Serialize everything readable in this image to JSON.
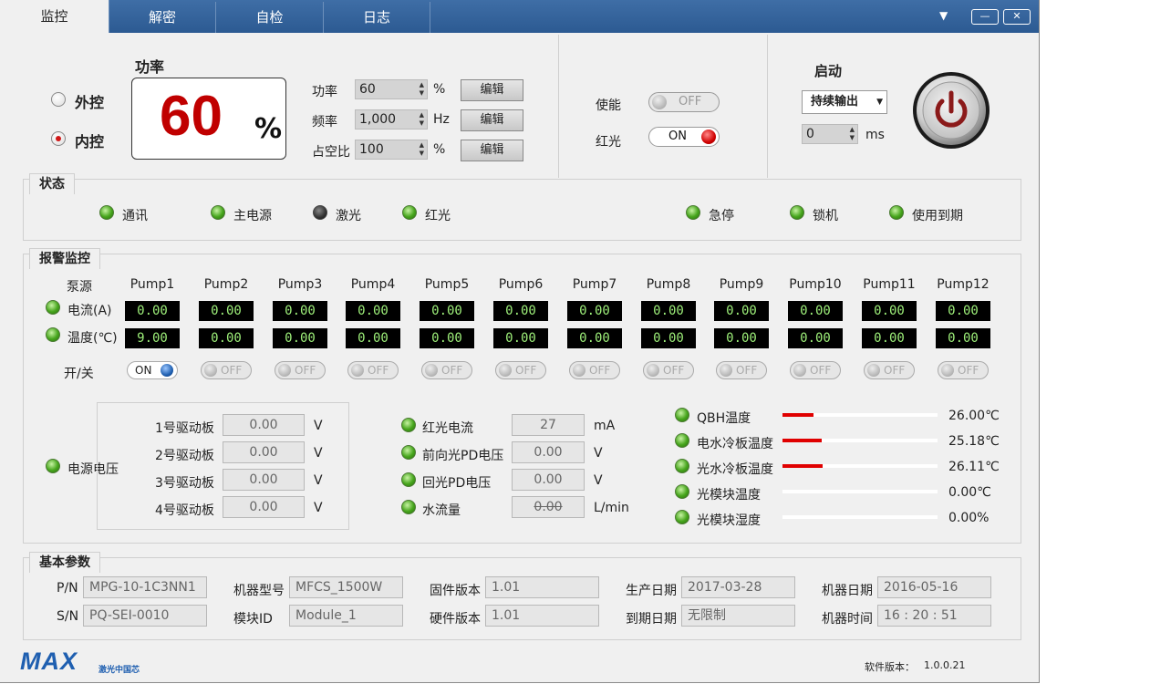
{
  "tabs": [
    {
      "label": "监控"
    },
    {
      "label": "解密"
    },
    {
      "label": "自检"
    },
    {
      "label": "日志"
    }
  ],
  "window_buttons": {
    "menu": "▼",
    "minimize": "—",
    "close": "✕"
  },
  "control": {
    "external_label": "外控",
    "internal_label": "内控",
    "selected": "内控"
  },
  "power": {
    "title": "功率",
    "display_value": "60",
    "display_unit": "%"
  },
  "params": [
    {
      "label": "功率",
      "value": "60",
      "unit": "%",
      "button": "编辑"
    },
    {
      "label": "频率",
      "value": "1,000",
      "unit": "Hz",
      "button": "编辑"
    },
    {
      "label": "占空比",
      "value": "100",
      "unit": "%",
      "button": "编辑"
    }
  ],
  "enable": {
    "label": "使能",
    "state": "OFF"
  },
  "red_light": {
    "label": "红光",
    "state": "ON"
  },
  "start": {
    "title": "启动",
    "mode": "持续输出",
    "delay_value": "0",
    "delay_unit": "ms"
  },
  "status": {
    "title": "状态",
    "items": [
      {
        "label": "通讯",
        "on": true
      },
      {
        "label": "主电源",
        "on": true
      },
      {
        "label": "激光",
        "on": false
      },
      {
        "label": "红光",
        "on": true
      },
      {
        "label": "急停",
        "on": true
      },
      {
        "label": "锁机",
        "on": true
      },
      {
        "label": "使用到期",
        "on": true
      }
    ]
  },
  "alarm": {
    "title": "报警监控",
    "row_header": "泵源",
    "current_label": "电流(A)",
    "temp_label": "温度(℃)",
    "switch_label": "开/关",
    "pumps": [
      {
        "name": "Pump1",
        "current": "0.00",
        "temp": "9.00",
        "switch": "ON"
      },
      {
        "name": "Pump2",
        "current": "0.00",
        "temp": "0.00",
        "switch": "OFF"
      },
      {
        "name": "Pump3",
        "current": "0.00",
        "temp": "0.00",
        "switch": "OFF"
      },
      {
        "name": "Pump4",
        "current": "0.00",
        "temp": "0.00",
        "switch": "OFF"
      },
      {
        "name": "Pump5",
        "current": "0.00",
        "temp": "0.00",
        "switch": "OFF"
      },
      {
        "name": "Pump6",
        "current": "0.00",
        "temp": "0.00",
        "switch": "OFF"
      },
      {
        "name": "Pump7",
        "current": "0.00",
        "temp": "0.00",
        "switch": "OFF"
      },
      {
        "name": "Pump8",
        "current": "0.00",
        "temp": "0.00",
        "switch": "OFF"
      },
      {
        "name": "Pump9",
        "current": "0.00",
        "temp": "0.00",
        "switch": "OFF"
      },
      {
        "name": "Pump10",
        "current": "0.00",
        "temp": "0.00",
        "switch": "OFF"
      },
      {
        "name": "Pump11",
        "current": "0.00",
        "temp": "0.00",
        "switch": "OFF"
      },
      {
        "name": "Pump12",
        "current": "0.00",
        "temp": "0.00",
        "switch": "OFF"
      }
    ],
    "supply": {
      "label": "电源电压",
      "boards": [
        {
          "label": "1号驱动板",
          "value": "0.00",
          "unit": "V"
        },
        {
          "label": "2号驱动板",
          "value": "0.00",
          "unit": "V"
        },
        {
          "label": "3号驱动板",
          "value": "0.00",
          "unit": "V"
        },
        {
          "label": "4号驱动板",
          "value": "0.00",
          "unit": "V"
        }
      ]
    },
    "mid": [
      {
        "label": "红光电流",
        "value": "27",
        "unit": "mA"
      },
      {
        "label": "前向光PD电压",
        "value": "0.00",
        "unit": "V"
      },
      {
        "label": "回光PD电压",
        "value": "0.00",
        "unit": "V"
      },
      {
        "label": "水流量",
        "value": "0.00",
        "unit": "L/min"
      }
    ],
    "temps": [
      {
        "label": "QBH温度",
        "value": "26.00℃",
        "level": 0.2
      },
      {
        "label": "电水冷板温度",
        "value": "25.18℃",
        "level": 0.25
      },
      {
        "label": "光水冷板温度",
        "value": "26.11℃",
        "level": 0.26
      },
      {
        "label": "光模块温度",
        "value": "0.00℃",
        "level": 0
      },
      {
        "label": "光模块湿度",
        "value": "0.00%",
        "level": 0
      }
    ]
  },
  "basic": {
    "title": "基本参数",
    "pn_label": "P/N",
    "pn": "MPG-10-1C3NN1",
    "sn_label": "S/N",
    "sn": "PQ-SEI-0010",
    "model_label": "机器型号",
    "model": "MFCS_1500W",
    "module_label": "模块ID",
    "module": "Module_1",
    "fw_label": "固件版本",
    "fw": "1.01",
    "hw_label": "硬件版本",
    "hw": "1.01",
    "mfg_label": "生产日期",
    "mfg": "2017-03-28",
    "exp_label": "到期日期",
    "exp": "无限制",
    "mdate_label": "机器日期",
    "mdate": "2016-05-16",
    "mtime_label": "机器时间",
    "mtime": "16 : 20 : 51"
  },
  "footer": {
    "logo": "MAX",
    "logo_sub": "激光中国芯",
    "version_label": "软件版本：",
    "version": "1.0.0.21"
  },
  "colors": {
    "accent": "#2c5a92",
    "alarm_red": "#c00000",
    "led_green": "#46a51c",
    "bar_red": "#e00000"
  }
}
